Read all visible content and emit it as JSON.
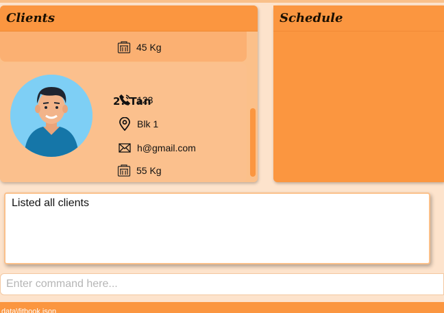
{
  "clients_panel": {
    "title": "Clients",
    "previous_card": {
      "weight": "45 Kg"
    },
    "card": {
      "name": "2. Tan",
      "phone": "123",
      "address": "Blk 1",
      "email": "h@gmail.com",
      "weight": "55 Kg"
    }
  },
  "schedule_panel": {
    "title": "Schedule"
  },
  "result_display": {
    "text": "Listed all clients"
  },
  "command_box": {
    "placeholder": "Enter command here..."
  },
  "status_bar": {
    "path": "data\\fitbook.json"
  },
  "colors": {
    "accent": "#fb9640",
    "panel": "#fbc08a",
    "background": "#fde3cc"
  },
  "icons": [
    "weight-scale-icon",
    "phone-icon",
    "location-pin-icon",
    "mail-icon"
  ]
}
